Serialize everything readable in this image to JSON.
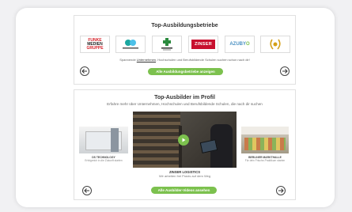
{
  "top_betriebe": {
    "title": "Top-Ausbildungsbetriebe",
    "logos": [
      "FUNKE MEDIEN GRUPPE",
      "DS TECHNOLOGY",
      "Stadtwerke",
      "ZINSER",
      "AZUBYO",
      "Award"
    ],
    "note_prefix": "Spannende ",
    "note_link": "Unternehmen",
    "note_suffix": ", Hochschulen und Berufsbildende Schulen suchen schon nach dir!",
    "button_label": "Alle Ausbildungsbetriebe anzeigen"
  },
  "top_ausbilder": {
    "title": "Top-Ausbilder im Profil",
    "subtitle": "Erfahre mehr über Unternehmen, Hochschulen und Berufsbildende Schulen, die nach dir suchen",
    "left_card": {
      "name": "DS TECHNOLOGY",
      "desc": "Erfolgreich in die Zukunft starten"
    },
    "main_card": {
      "name": "ZINSER LOGISTICS",
      "desc": "Wir arbeiten frei Praxis auf dem Weg"
    },
    "right_card": {
      "name": "BERLINER MARKTHALLE",
      "desc": "Für dein Frische-Praktikum starten"
    },
    "button_label": "Alle Ausbilder-Videos ansehen"
  },
  "colors": {
    "accent": "#7cc14e",
    "funke_red": "#d6222a",
    "zinser_red": "#c8102e",
    "teal": "#1aa7a0"
  },
  "icons": [
    "arrow-left-icon",
    "arrow-right-icon",
    "play-icon"
  ]
}
